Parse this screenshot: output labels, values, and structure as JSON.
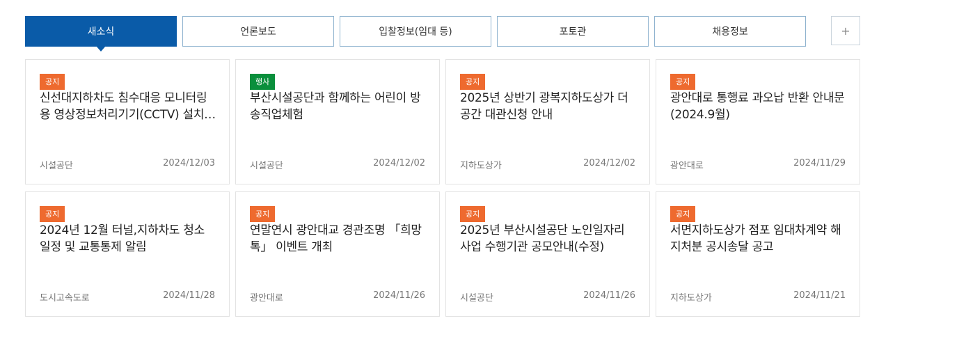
{
  "tabs": [
    {
      "label": "새소식",
      "active": true
    },
    {
      "label": "언론보도",
      "active": false
    },
    {
      "label": "입찰정보(임대 등)",
      "active": false
    },
    {
      "label": "포토관",
      "active": false
    },
    {
      "label": "채용정보",
      "active": false
    }
  ],
  "more_label": "+",
  "colors": {
    "primary": "#0a5ba8",
    "notice": "#ee6a2f",
    "event": "#0a8f3c"
  },
  "cards": [
    {
      "badge": "공지",
      "badge_type": "notice",
      "title": "신선대지하차도 침수대응 모니터링용 영상정보처리기기(CCTV) 설치 운영 안내",
      "source": "시설공단",
      "date": "2024/12/03"
    },
    {
      "badge": "행사",
      "badge_type": "event",
      "title": "부산시설공단과 함께하는 어린이 방송직업체험",
      "source": "시설공단",
      "date": "2024/12/02"
    },
    {
      "badge": "공지",
      "badge_type": "notice",
      "title": "2025년 상반기 광복지하도상가 더 공간 대관신청 안내",
      "source": "지하도상가",
      "date": "2024/12/02"
    },
    {
      "badge": "공지",
      "badge_type": "notice",
      "title": "광안대로 통행료 과오납 반환 안내문(2024.9월)",
      "source": "광안대로",
      "date": "2024/11/29"
    },
    {
      "badge": "공지",
      "badge_type": "notice",
      "title": "2024년 12월 터널,지하차도 청소 일정 및 교통통제 알림",
      "source": "도시고속도로",
      "date": "2024/11/28"
    },
    {
      "badge": "공지",
      "badge_type": "notice",
      "title": "연말연시 광안대교 경관조명 「희망톡」 이벤트 개최",
      "source": "광안대로",
      "date": "2024/11/26"
    },
    {
      "badge": "공지",
      "badge_type": "notice",
      "title": "2025년 부산시설공단 노인일자리 사업 수행기관 공모안내(수정)",
      "source": "시설공단",
      "date": "2024/11/26"
    },
    {
      "badge": "공지",
      "badge_type": "notice",
      "title": "서면지하도상가 점포 임대차계약 해지처분 공시송달 공고",
      "source": "지하도상가",
      "date": "2024/11/21"
    }
  ]
}
